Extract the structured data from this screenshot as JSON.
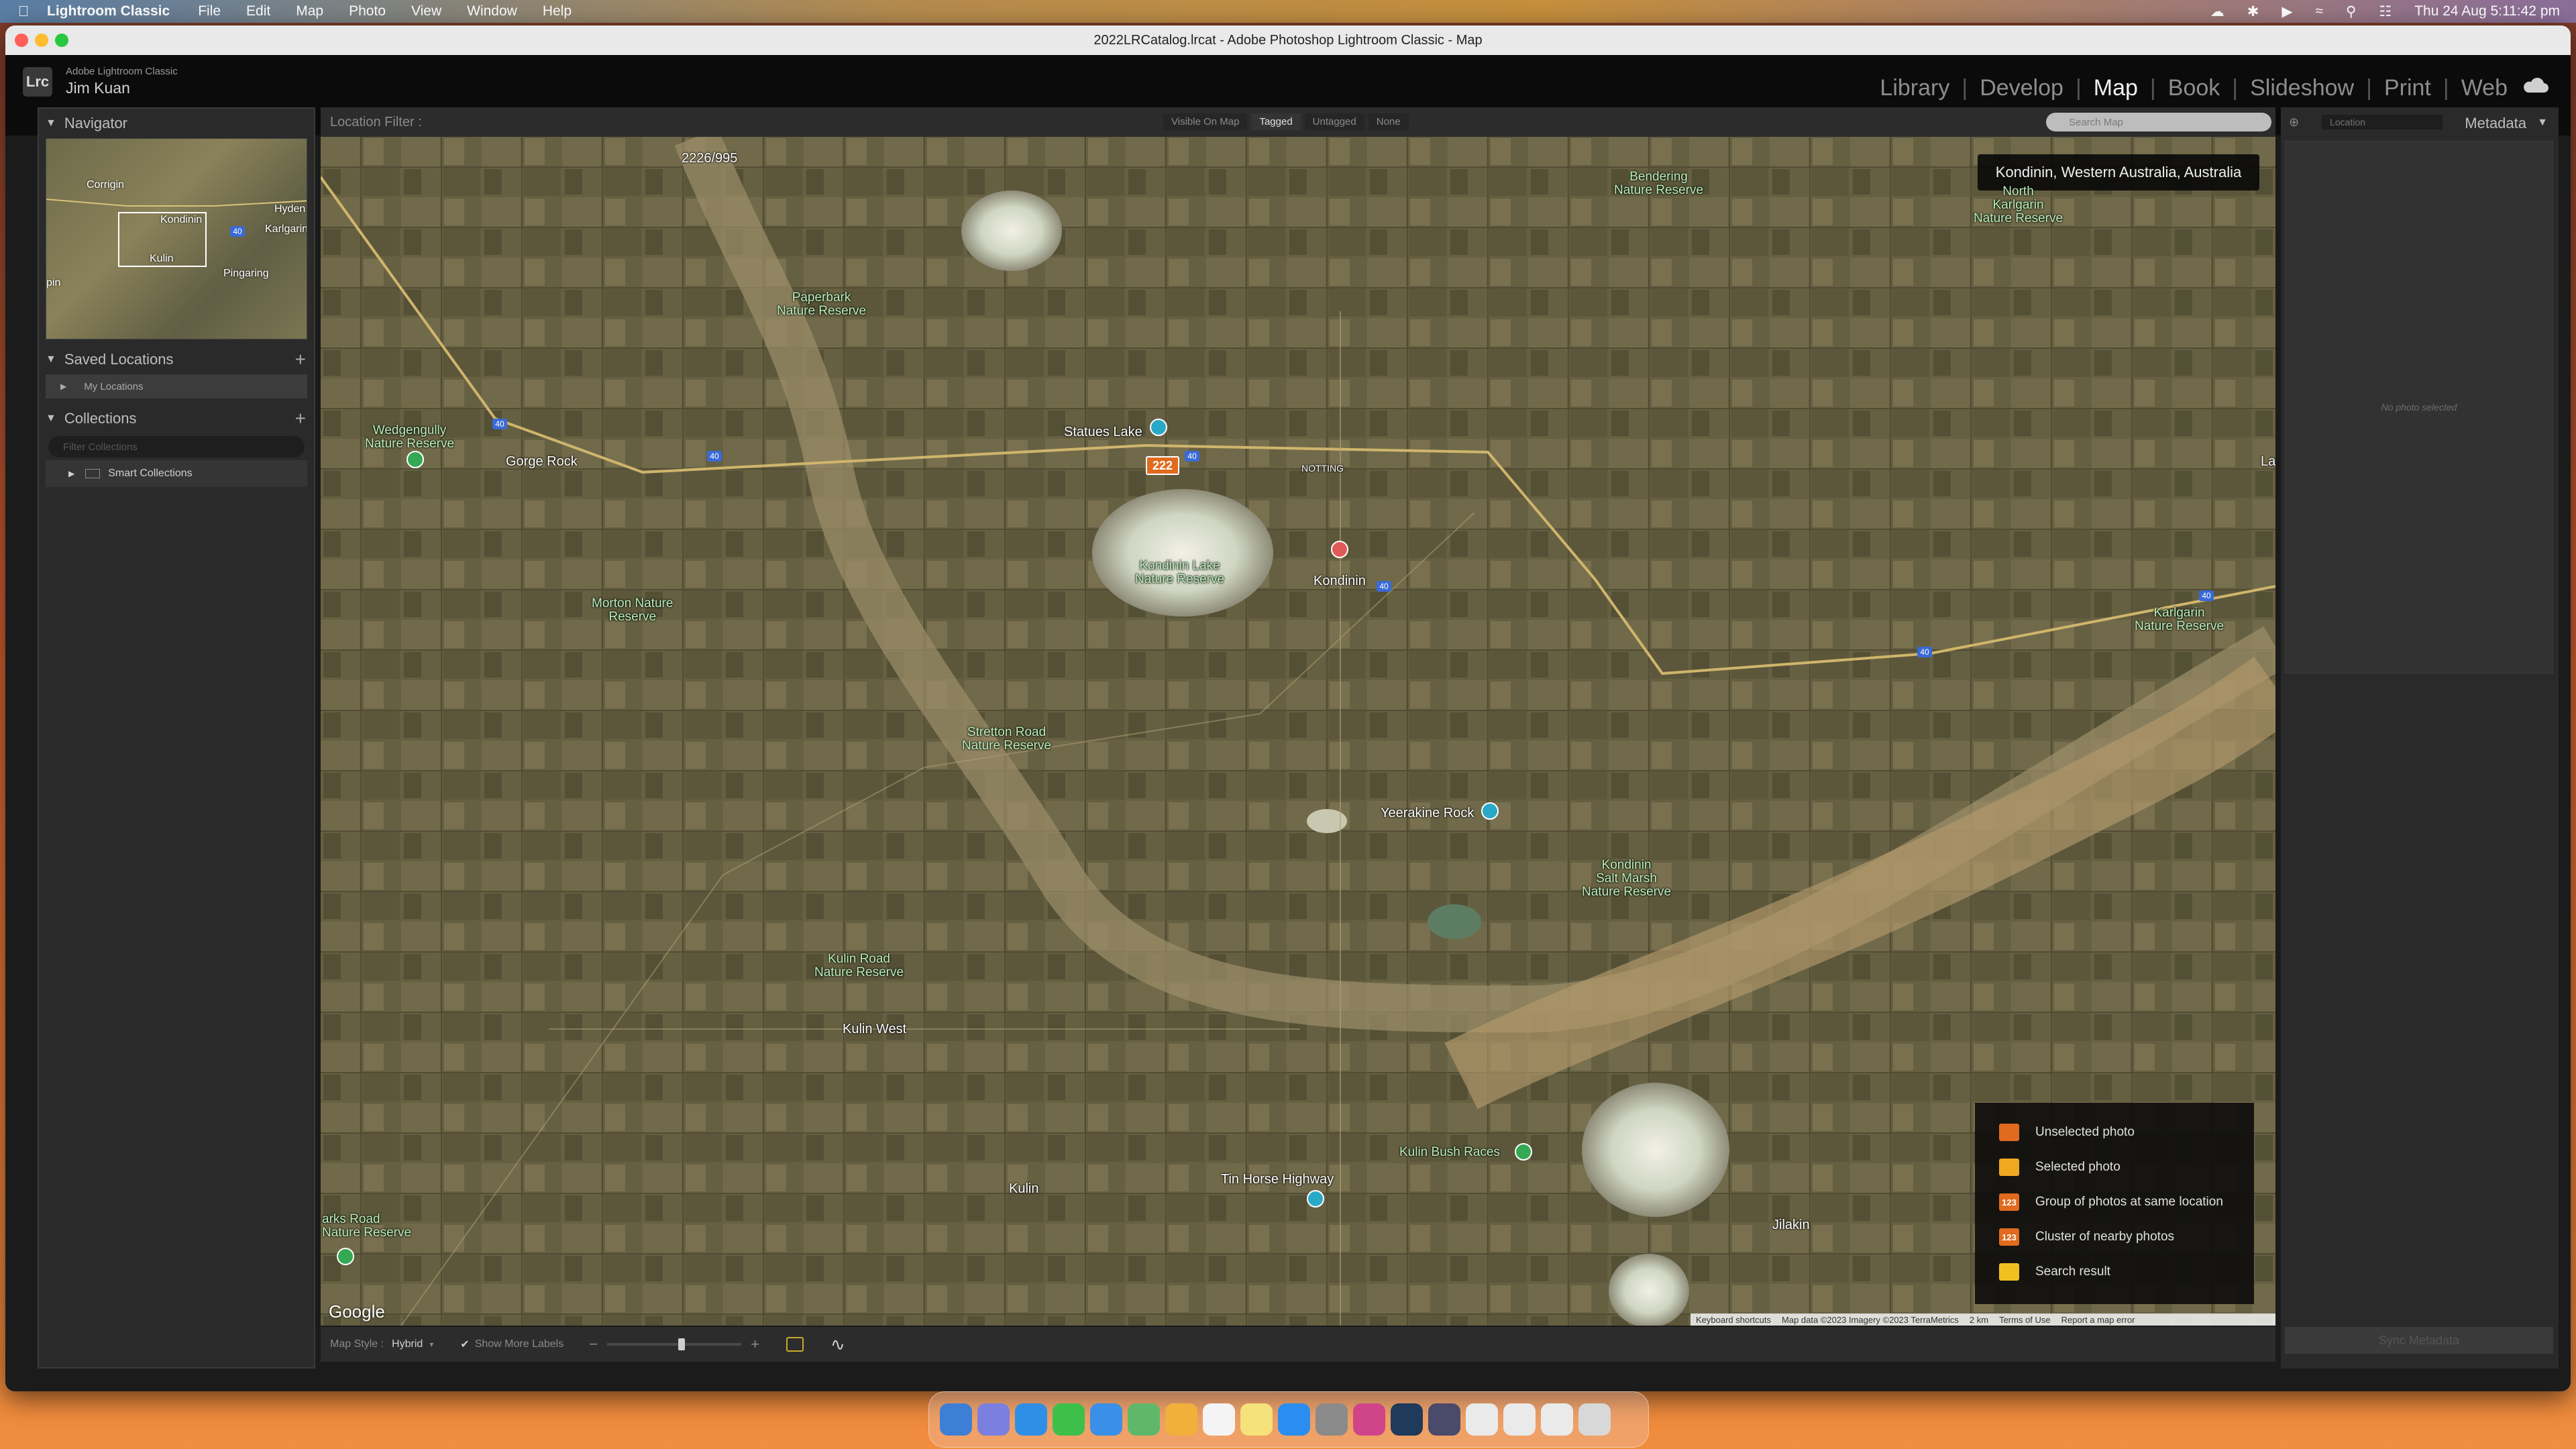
{
  "menubar": {
    "app": "Lightroom Classic",
    "items": [
      "File",
      "Edit",
      "Map",
      "Photo",
      "View",
      "Window",
      "Help"
    ],
    "datetime": "Thu 24 Aug  5:11:42 pm"
  },
  "window": {
    "title": "2022LRCatalog.lrcat - Adobe Photoshop Lightroom Classic - Map"
  },
  "identity": {
    "product": "Adobe Lightroom Classic",
    "user": "Jim Kuan",
    "logo": "Lrc"
  },
  "modules": [
    "Library",
    "Develop",
    "Map",
    "Book",
    "Slideshow",
    "Print",
    "Web"
  ],
  "active_module": "Map",
  "left_panel": {
    "navigator": "Navigator",
    "nav_labels": [
      "Corrigin",
      "Hyden",
      "Kondinin",
      "Karlgarin",
      "Kulin",
      "Pingaring",
      "pin",
      "40"
    ],
    "saved_locations": "Saved Locations",
    "my_locations": "My Locations",
    "collections": "Collections",
    "filter_placeholder": "Filter Collections",
    "smart_collections": "Smart Collections"
  },
  "location_filter": {
    "label": "Location Filter :",
    "chips": [
      "Visible On Map",
      "Tagged",
      "Untagged",
      "None"
    ],
    "active_chip": "Tagged",
    "search_placeholder": "Search Map"
  },
  "map": {
    "current_location": "Kondinin, Western Australia, Australia",
    "cluster_count": "222",
    "google": "Google",
    "places": [
      {
        "t": "2226/995",
        "g": false
      },
      {
        "t": "Paperbark\nNature Reserve",
        "g": true
      },
      {
        "t": "Bendering\nNature Reserve",
        "g": true
      },
      {
        "t": "North\nKarlgarin\nNature Reserve",
        "g": true
      },
      {
        "t": "Wedgengully\nNature Reserve",
        "g": true
      },
      {
        "t": "Gorge Rock",
        "g": false
      },
      {
        "t": "Statues Lake",
        "g": false
      },
      {
        "t": "NOTTING",
        "g": false
      },
      {
        "t": "Kondinin Lake\nNature Reserve",
        "g": true
      },
      {
        "t": "Kondinin",
        "g": false
      },
      {
        "t": "Morton Nature\nReserve",
        "g": true
      },
      {
        "t": "Karlgarin\nNature Reserve",
        "g": true
      },
      {
        "t": "Stretton Road\nNature Reserve",
        "g": true
      },
      {
        "t": "Yeerakine Rock",
        "g": false
      },
      {
        "t": "Kondinin\nSalt Marsh\nNature Reserve",
        "g": true
      },
      {
        "t": "Kulin Road\nNature Reserve",
        "g": true
      },
      {
        "t": "Kulin West",
        "g": false
      },
      {
        "t": "Kulin",
        "g": false
      },
      {
        "t": "Tin Horse Highway",
        "g": false
      },
      {
        "t": "Kulin Bush Races",
        "g": true
      },
      {
        "t": "Jilakin",
        "g": false
      },
      {
        "t": "arks Road\nNature Reserve",
        "g": true
      },
      {
        "t": "La",
        "g": false
      }
    ],
    "road_number": "40",
    "legend": [
      {
        "label": "Unselected photo",
        "color": "#e06a1e",
        "badge": ""
      },
      {
        "label": "Selected photo",
        "color": "#f0a820",
        "badge": ""
      },
      {
        "label": "Group of photos at same location",
        "color": "#e06a1e",
        "badge": "123"
      },
      {
        "label": "Cluster of nearby photos",
        "color": "#e06a1e",
        "badge": "123"
      },
      {
        "label": "Search result",
        "color": "#f0c020",
        "badge": ""
      }
    ],
    "attribution": [
      "Keyboard shortcuts",
      "Map data ©2023 Imagery ©2023 TerraMetrics",
      "2 km",
      "Terms of Use",
      "Report a map error"
    ]
  },
  "bottom_bar": {
    "map_style_label": "Map Style :",
    "map_style_value": "Hybrid",
    "show_more_labels": "Show More Labels",
    "zoom_level": 0.56
  },
  "right_panel": {
    "location_dropdown": "Location",
    "metadata": "Metadata",
    "empty_text": "No photo selected",
    "sync": "Sync Metadata"
  }
}
